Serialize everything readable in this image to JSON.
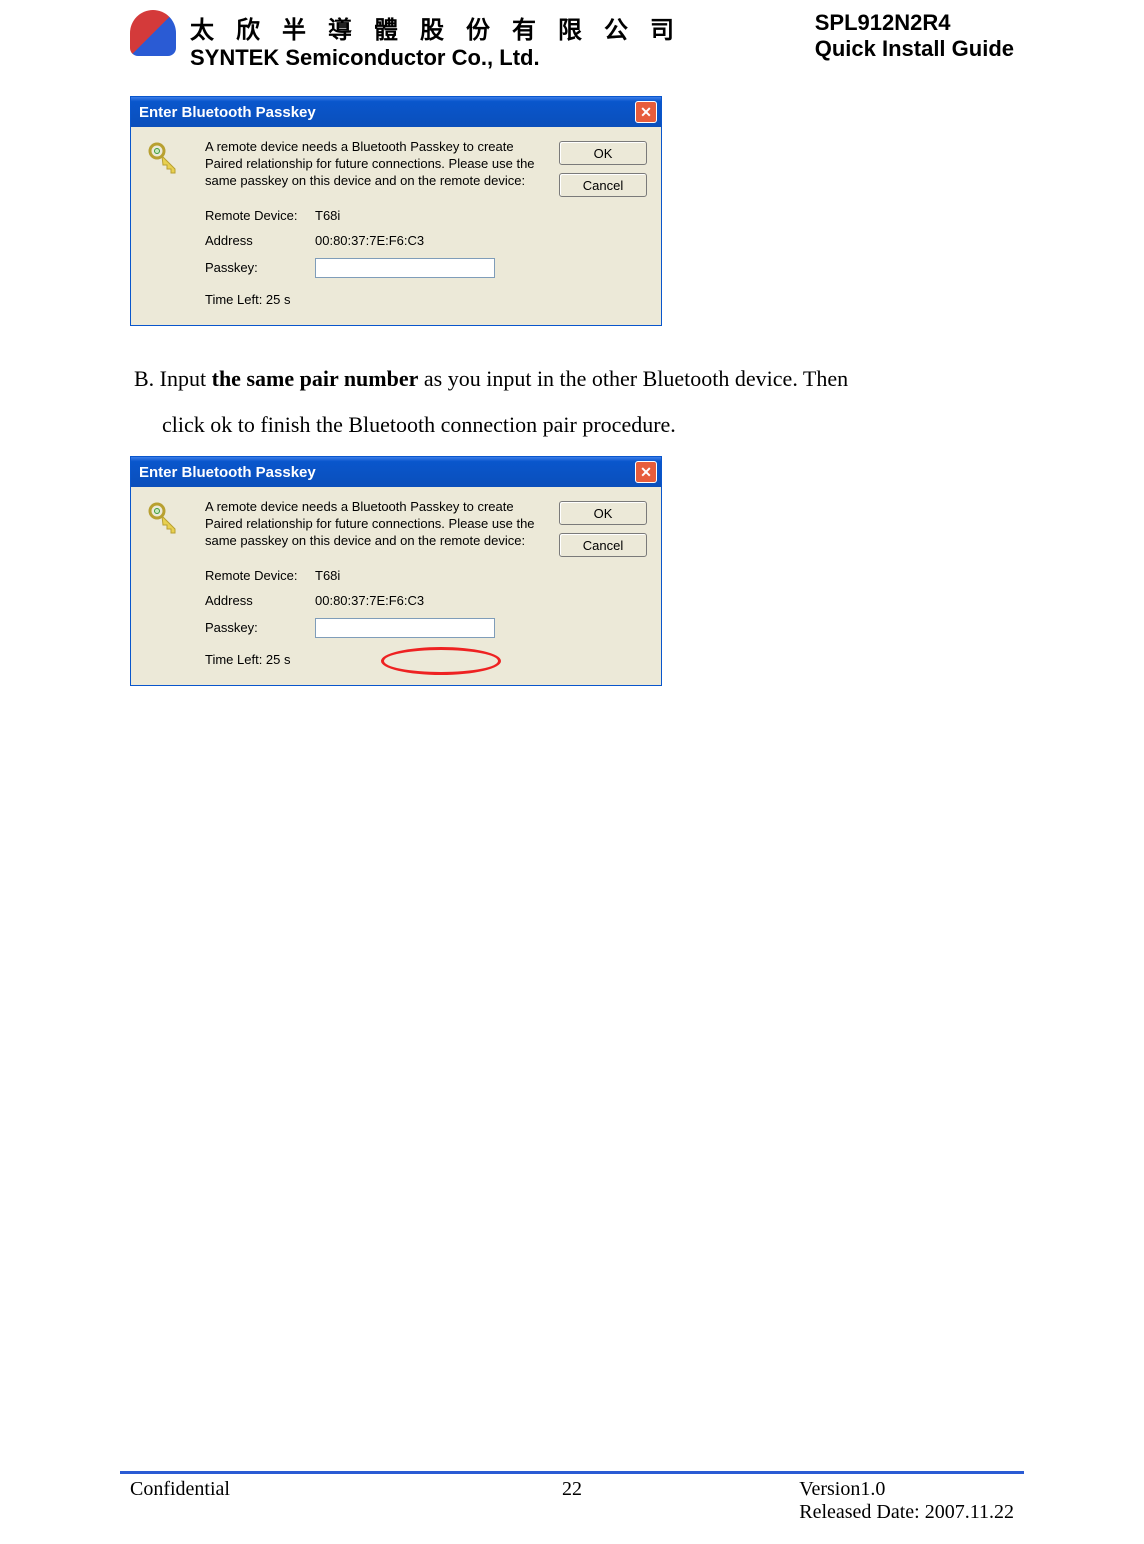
{
  "header": {
    "company_chinese": "太 欣 半 導 體 股 份 有 限 公 司",
    "company_english": "SYNTEK Semiconductor Co., Ltd.",
    "product": "SPL912N2R4",
    "guide": "Quick Install Guide"
  },
  "dialog": {
    "title": "Enter Bluetooth Passkey",
    "description": "A remote device needs a Bluetooth Passkey to create Paired relationship for future connections. Please use the same passkey on this device and on the remote device:",
    "ok_label": "OK",
    "cancel_label": "Cancel",
    "remote_device_label": "Remote Device:",
    "remote_device_value": "T68i",
    "address_label": "Address",
    "address_value": "00:80:37:7E:F6:C3",
    "passkey_label": "Passkey:",
    "passkey_value": "",
    "time_left": "Time Left: 25 s"
  },
  "instruction": {
    "prefix": "B. Input ",
    "bold": "the same pair number",
    "suffix": " as you input in the other Bluetooth device. Then",
    "line2": "click ok to finish the Bluetooth connection pair procedure."
  },
  "footer": {
    "confidential": "Confidential",
    "page": "22",
    "version": "Version1.0",
    "released": "Released Date: 2007.11.22"
  }
}
